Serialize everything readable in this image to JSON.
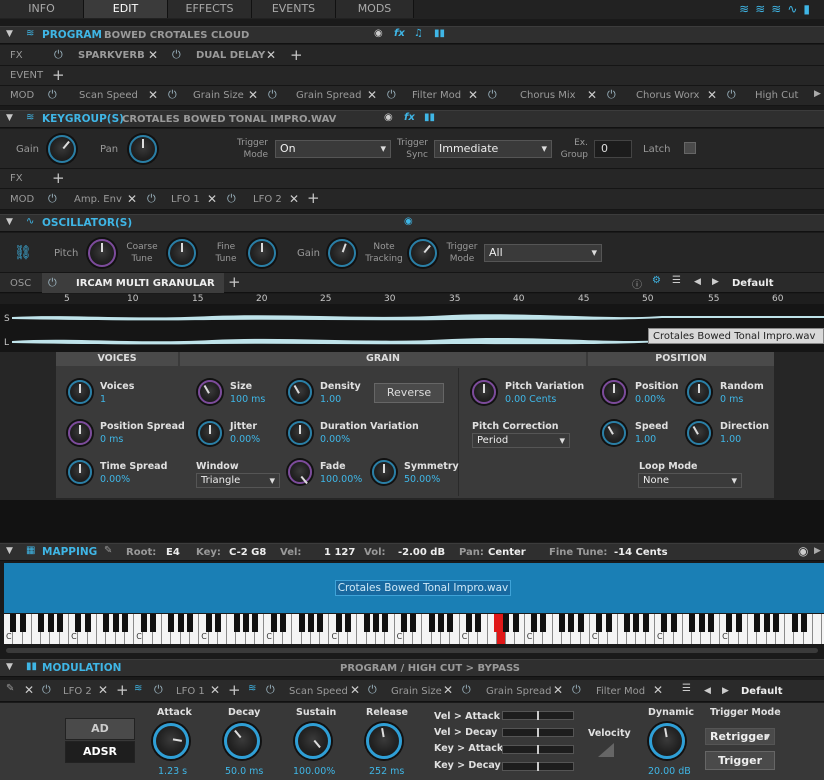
{
  "tabs": [
    "INFO",
    "EDIT",
    "EFFECTS",
    "EVENTS",
    "MODS"
  ],
  "program": {
    "title": "PROGRAM",
    "name": "BOWED CROTALES CLOUD",
    "fx_label": "FX",
    "fx_items": [
      "SPARKVERB",
      "DUAL DELAY"
    ],
    "event_label": "EVENT",
    "mod_label": "MOD",
    "mod_items": [
      "Scan Speed",
      "Grain Size",
      "Grain Spread",
      "Filter Mod",
      "Chorus Mix",
      "Chorus Worx",
      "High Cut"
    ]
  },
  "keygroup": {
    "title": "KEYGROUP(S)",
    "name": "CROTALES BOWED TONAL IMPRO.WAV",
    "gain": "Gain",
    "pan": "Pan",
    "trigger_mode_label": "Trigger Mode",
    "trigger_mode": "On",
    "trigger_sync_label": "Trigger Sync",
    "trigger_sync": "Immediate",
    "ex_group_label": "Ex. Group",
    "ex_group": "0",
    "latch": "Latch",
    "fx_label": "FX",
    "mod_label": "MOD",
    "mod_items": [
      "Amp. Env",
      "LFO 1",
      "LFO 2"
    ]
  },
  "oscillator": {
    "title": "OSCILLATOR(S)",
    "pitch": "Pitch",
    "coarse": "Coarse Tune",
    "fine": "Fine Tune",
    "gain": "Gain",
    "note_tracking": "Note Tracking",
    "trigger_mode_label": "Trigger Mode",
    "trigger_mode": "All",
    "osc_label": "OSC",
    "osc_name": "IRCAM MULTI GRANULAR",
    "preset": "Default",
    "ruler": [
      "5",
      "10",
      "15",
      "20",
      "25",
      "30",
      "35",
      "40",
      "45",
      "50",
      "55",
      "60"
    ],
    "s": "S",
    "l": "L",
    "sample_tooltip": "Crotales Bowed Tonal Impro.wav"
  },
  "granular": {
    "voices_title": "VOICES",
    "grain_title": "GRAIN",
    "position_title": "POSITION",
    "voices": {
      "label": "Voices",
      "value": "1"
    },
    "pos_spread": {
      "label": "Position Spread",
      "value": "0 ms"
    },
    "time_spread": {
      "label": "Time Spread",
      "value": "0.00%"
    },
    "size": {
      "label": "Size",
      "value": "100 ms"
    },
    "density": {
      "label": "Density",
      "value": "1.00"
    },
    "reverse": "Reverse",
    "jitter": {
      "label": "Jitter",
      "value": "0.00%"
    },
    "dur_var": {
      "label": "Duration Variation",
      "value": "0.00%"
    },
    "window_label": "Window",
    "window": "Triangle",
    "fade": {
      "label": "Fade",
      "value": "100.00%"
    },
    "symmetry": {
      "label": "Symmetry",
      "value": "50.00%"
    },
    "pitch_var": {
      "label": "Pitch Variation",
      "value": "0.00 Cents"
    },
    "pitch_corr_label": "Pitch Correction",
    "pitch_corr": "Period",
    "position": {
      "label": "Position",
      "value": "0.00%"
    },
    "random": {
      "label": "Random",
      "value": "0 ms"
    },
    "speed": {
      "label": "Speed",
      "value": "1.00"
    },
    "direction": {
      "label": "Direction",
      "value": "1.00"
    },
    "loop_label": "Loop Mode",
    "loop": "None"
  },
  "mapping": {
    "title": "MAPPING",
    "root_label": "Root:",
    "root": "E4",
    "key_label": "Key:",
    "key": "C-2 G8",
    "vel_label": "Vel:",
    "vel": "1 127",
    "vol_label": "Vol:",
    "vol": "-2.00 dB",
    "pan_label": "Pan:",
    "pan": "Center",
    "fine_label": "Fine Tune:",
    "fine": "-14 Cents",
    "zone": "Crotales Bowed Tonal Impro.wav"
  },
  "modulation": {
    "title": "MODULATION",
    "path": "PROGRAM / HIGH CUT > BYPASS",
    "tabs": [
      "LFO 2",
      "LFO 1",
      "Scan Speed",
      "Grain Size",
      "Grain Spread",
      "Filter Mod"
    ],
    "preset": "Default",
    "ad": "AD",
    "adsr": "ADSR",
    "attack": {
      "label": "Attack",
      "value": "1.23 s"
    },
    "decay": {
      "label": "Decay",
      "value": "50.0 ms"
    },
    "sustain": {
      "label": "Sustain",
      "value": "100.00%"
    },
    "release": {
      "label": "Release",
      "value": "252 ms"
    },
    "vel_attack": "Vel > Attack",
    "vel_decay": "Vel > Decay",
    "key_attack": "Key > Attack",
    "key_decay": "Key > Decay",
    "velocity": "Velocity",
    "dynamic": {
      "label": "Dynamic",
      "value": "20.00 dB"
    },
    "trigger_mode_label": "Trigger Mode",
    "trigger_mode": "Retrigger",
    "trigger": "Trigger"
  }
}
